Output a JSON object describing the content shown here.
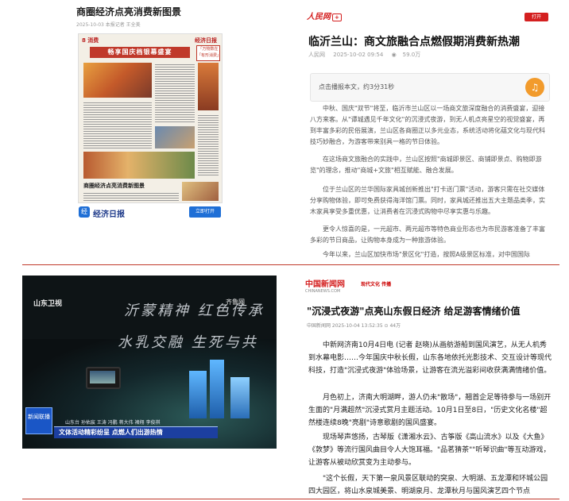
{
  "panel1": {
    "title": "商圈经济点亮消费新图景",
    "meta": "2025-10-03  本报记者 王全美",
    "paper_page": "8 消费",
    "paper_brand": "经济日报",
    "paper_banner": "畅享国庆档银幕盛宴",
    "paper_side": "「万物数在「有形消费」",
    "paper_subhead": "商圈经济点亮消费新图景",
    "source_name": "经济日报",
    "open_label": "立即打开"
  },
  "panel2": {
    "logo": "人民网",
    "logo_tag": "+",
    "open_label": "打开",
    "title": "临沂兰山：商文旅融合点燃假期消费新热潮",
    "source": "人民网",
    "date": "2025-10-02 09:54",
    "views": "59.0万",
    "audio_prompt": "点击播报本文，约3分31秒",
    "paragraphs": [
      "中秋、国庆\"双节\"将至，临沂市兰山区以一场商文旅深度融合的消费盛宴，迎接八方来客。从\"谭城遇见千年文化\"的沉浸式夜游，到无人机点亮星空的视觉盛宴，再到丰富多彩的民俗展演，兰山区各商圈正以多元业态，系统活动将化蕴文化与现代科技巧妙融合，为游客带来别具一格的节日体验。",
      "在这场商文旅融合的实践中，兰山区按照\"商城即景区、商铺即景点、购物即游览\"的理念，推动\"商城+文旅\"相互赋能、融合发展。",
      "位于兰山区的兰华国际家具城创新推出\"打卡送门票\"活动，游客只需在社交媒体分享购物体验，即可免费获得海洋馆门票。同时，家具城还推出五大主题品类季，实木家具享受多重优惠，让消费者在沉浸式购物中尽享实惠与乐趣。",
      "更令人惊喜的是，一元超市、两元超市等特色商业形态也为市民游客准备了丰富多彩的节日商品，让购物本身成为一种旅游体验。",
      "今年以来，兰山区加快市场\"景区化\"打造，按照A级景区标准，对中国国际"
    ]
  },
  "video": {
    "logo_left": "山东卫视",
    "logo_right": "齐鲁网",
    "script_line1": "沂蒙精神  红色传承",
    "script_line2": "水乳交融  生死与共",
    "badge": "新闻联播",
    "credits": "山东台 孙佑宸 王涛 冯鹏 蒋大伟 褚翔 李俊祺",
    "ticker": "文体活动精彩纷呈 点燃人们出游热情"
  },
  "panel4": {
    "logo": "中国新闻网",
    "logo_sub": "CHINANEWS.COM",
    "logo2": "现代文化 传播",
    "title": "\"沉浸式夜游\"点亮山东假日经济 给足游客情绪价值",
    "meta": "中国新闻网 2025-10-04 13:52:35  ⊙ 44万",
    "paragraphs": [
      "中新网济南10月4日电 (记者 赵晓)从画舫游船到国风演艺，从无人机秀到水幕电影……今年国庆中秋长假，山东各地依托光影技术、交互设计等现代科技，打造\"沉浸式夜游\"体验场景，让游客在流光溢彩间收获满满情绪价值。",
      "月色初上，济南大明湖畔，游人仍未\"散场\"，翘首企足等待参与一场别开生面的\"月满超然\"沉浸式赏月主题活动。10月1日至8日，\"历史文化名楼\"超然楼连续8晚\"亮剧\"诗意歌剧的国风盛宴。",
      "现场琴声悠扬，古琴版《潇湘水云》、古筝版《高山流水》以及《大鱼》《敦梦》等流行国风曲目令人大饱耳福。\"品茗猜茶\"\"听琴识曲\"等互动游戏，让游客从被动欣赏变为主动参与。",
      "\"这个长假，天下第一泉风景区联动的突泉、大明湖、五龙潭和环城公园四大园区，将山水泉城美景、明湖泉月、龙潭秋月与国风演艺四个节点"
    ]
  }
}
